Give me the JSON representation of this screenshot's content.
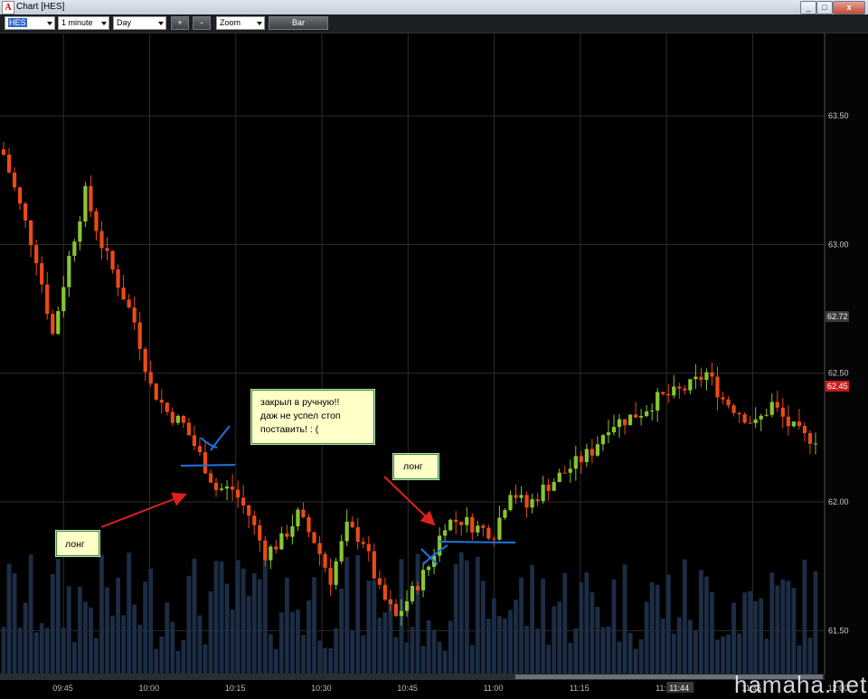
{
  "window": {
    "title": "Chart [HES]",
    "app_icon": "A",
    "controls": [
      "_",
      "□",
      "x"
    ]
  },
  "toolbar": {
    "symbol": "HES",
    "interval": "1 minute",
    "period": "Day",
    "plus_label": "+",
    "minus_label": "-",
    "zoom_label": "Zoom",
    "chart_type_label": "Bar"
  },
  "notes": {
    "long1": "лонг",
    "long2": "лонг",
    "closed": [
      "закрыл в ручную!!",
      "даж не успел стоп",
      "поставить! : ("
    ]
  },
  "colors": {
    "up": "#88c532",
    "down": "#ea4a17",
    "volume": "#1c2d45",
    "grid": "#2c2c2c",
    "annotation_blue": "#1f73e0",
    "annotation_red": "#e01f1f"
  },
  "watermark": "hamaha.net",
  "chart_data": {
    "type": "candlestick",
    "symbol": "HES",
    "price_axis": {
      "ticks": [
        63.5,
        63.0,
        62.5,
        62.0,
        61.5
      ],
      "tick_labels": [
        "63.50",
        "63.00",
        "62.50",
        "62.00",
        "61.50"
      ],
      "ylim": [
        61.35,
        63.75
      ]
    },
    "markers": {
      "last_price": "62.72",
      "current_price": "62.45"
    },
    "time_axis": {
      "labels": [
        "09:45",
        "10:00",
        "10:15",
        "10:30",
        "10:45",
        "11:00",
        "11:15",
        "11:30",
        "11:45",
        "12:00"
      ],
      "current_time": "11:44"
    },
    "grid": true,
    "path_points": [
      [
        0,
        63.35
      ],
      [
        3,
        63.15
      ],
      [
        6,
        62.95
      ],
      [
        9,
        62.65
      ],
      [
        12,
        62.95
      ],
      [
        15,
        63.2
      ],
      [
        18,
        63.0
      ],
      [
        21,
        62.85
      ],
      [
        24,
        62.7
      ],
      [
        27,
        62.45
      ],
      [
        30,
        62.35
      ],
      [
        33,
        62.3
      ],
      [
        36,
        62.18
      ],
      [
        39,
        62.05
      ],
      [
        42,
        62.05
      ],
      [
        45,
        61.95
      ],
      [
        48,
        61.8
      ],
      [
        51,
        61.85
      ],
      [
        54,
        61.95
      ],
      [
        57,
        61.85
      ],
      [
        60,
        61.7
      ],
      [
        63,
        61.9
      ],
      [
        66,
        61.85
      ],
      [
        69,
        61.65
      ],
      [
        72,
        61.55
      ],
      [
        75,
        61.65
      ],
      [
        78,
        61.75
      ],
      [
        81,
        61.92
      ],
      [
        84,
        61.93
      ],
      [
        87,
        61.9
      ],
      [
        90,
        61.88
      ],
      [
        93,
        62.05
      ],
      [
        96,
        61.98
      ],
      [
        99,
        62.05
      ],
      [
        102,
        62.1
      ],
      [
        105,
        62.15
      ],
      [
        108,
        62.2
      ],
      [
        111,
        62.3
      ],
      [
        114,
        62.32
      ],
      [
        117,
        62.35
      ],
      [
        120,
        62.4
      ],
      [
        123,
        62.42
      ],
      [
        126,
        62.45
      ],
      [
        129,
        62.5
      ],
      [
        132,
        62.4
      ],
      [
        135,
        62.35
      ],
      [
        138,
        62.3
      ],
      [
        141,
        62.38
      ],
      [
        144,
        62.3
      ],
      [
        147,
        62.25
      ]
    ]
  }
}
